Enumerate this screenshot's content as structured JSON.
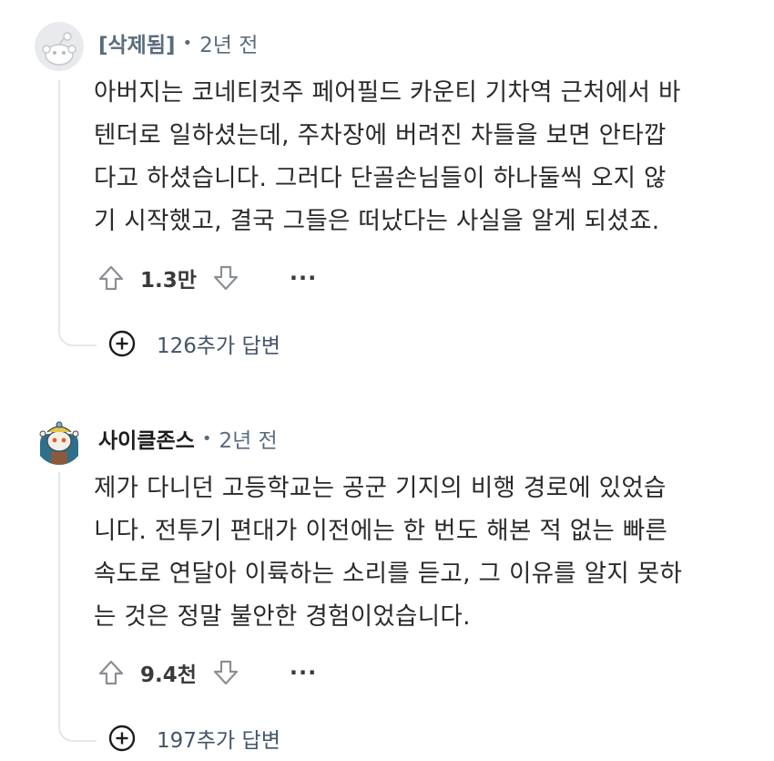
{
  "comments": [
    {
      "author": "[삭제됨]",
      "age": "2년 전",
      "lines": [
        "아버지는 코네티컷주 페어필드 카운티 기차역 근처에서 바",
        "텐더로 일하셨는데, 주차장에 버려진 차들을 보면 안타깝",
        "다고 하셨습니다. 그러다 단골손님들이 하나둘씩 오지 않",
        "기 시작했고, 결국 그들은 떠났다는 사실을 알게 되셨죠."
      ],
      "score": "1.3만",
      "replies": "126추가 답변"
    },
    {
      "author": "사이클존스",
      "age": "2년 전",
      "lines": [
        "제가 다니던 고등학교는 공군 기지의 비행 경로에 있었습",
        "니다. 전투기 편대가 이전에는 한 번도 해본 적 없는 빠른",
        "속도로 연달아 이륙하는 소리를 듣고, 그 이유를 알지 못하",
        "는 것은 정말 불안한 경험이었습니다."
      ],
      "score": "9.4천",
      "replies": "197추가 답변"
    }
  ],
  "separator": "•",
  "more_label": "···",
  "icons": {
    "upvote": "upvote-arrow-icon",
    "downvote": "downvote-arrow-icon",
    "more": "more-options-icon",
    "expand": "expand-plus-icon"
  },
  "colors": {
    "deleted_author": "#5a6b7c",
    "thread_line": "#e4e6e8",
    "reply_link": "#44546a"
  }
}
